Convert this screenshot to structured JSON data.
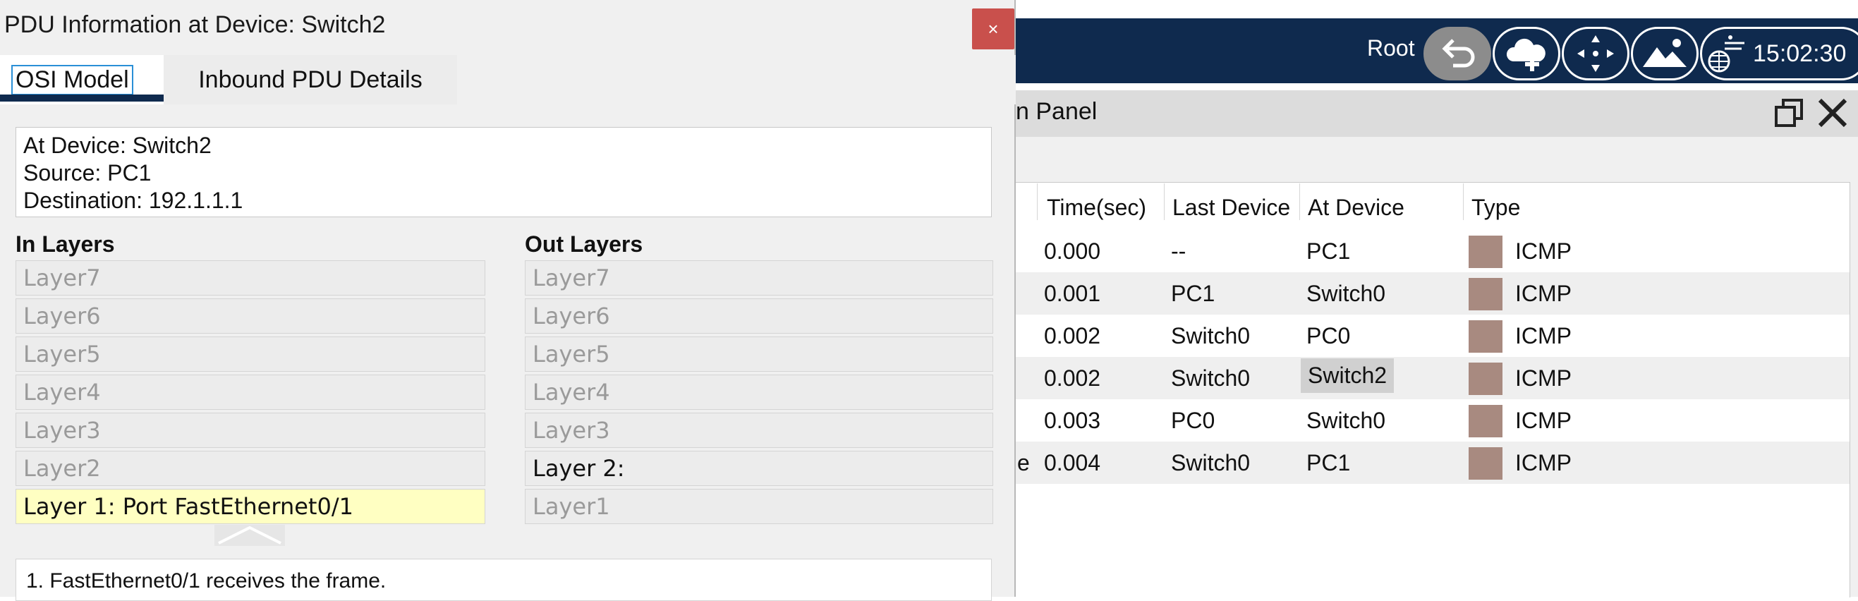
{
  "dialog": {
    "title": "PDU Information at Device: Switch2",
    "close_label": "×",
    "tabs": [
      {
        "label": "OSI Model",
        "active": true
      },
      {
        "label": "Inbound PDU Details",
        "active": false
      }
    ],
    "info_lines": [
      "At Device: Switch2",
      "Source: PC1",
      "Destination: 192.1.1.1"
    ],
    "in_layers": {
      "title": "In Layers",
      "items": [
        "Layer7",
        "Layer6",
        "Layer5",
        "Layer4",
        "Layer3",
        "Layer2",
        "Layer 1: Port FastEthernet0/1"
      ],
      "active_index": 6
    },
    "out_layers": {
      "title": "Out Layers",
      "items": [
        "Layer7",
        "Layer6",
        "Layer5",
        "Layer4",
        "Layer3",
        "Layer 2:",
        "Layer1"
      ],
      "enabled_index": 5
    },
    "description": "1. FastEthernet0/1 receives the frame."
  },
  "app": {
    "user_label": "Root",
    "clock": "15:02:30",
    "toolbar_icons": [
      "undo-icon",
      "cloud-add-icon",
      "move-icon",
      "landscape-icon",
      "network-clock-icon"
    ],
    "panel_title_fragment": "n Panel",
    "colors": {
      "topbar": "#0f2a4e",
      "type_swatch": "#a88a80",
      "dialog_close": "#c9504c",
      "active_layer": "#ffffc2"
    }
  },
  "event_table": {
    "headers": [
      "Time(sec)",
      "Last Device",
      "At Device",
      "Type"
    ],
    "rows": [
      {
        "lead": "",
        "time": "0.000",
        "last": "--",
        "at": "PC1",
        "type": "ICMP"
      },
      {
        "lead": "",
        "time": "0.001",
        "last": "PC1",
        "at": "Switch0",
        "type": "ICMP"
      },
      {
        "lead": "",
        "time": "0.002",
        "last": "Switch0",
        "at": "PC0",
        "type": "ICMP"
      },
      {
        "lead": "",
        "time": "0.002",
        "last": "Switch0",
        "at": "Switch2",
        "type": "ICMP",
        "highlight": true
      },
      {
        "lead": "",
        "time": "0.003",
        "last": "PC0",
        "at": "Switch0",
        "type": "ICMP"
      },
      {
        "lead": "e",
        "time": "0.004",
        "last": "Switch0",
        "at": "PC1",
        "type": "ICMP"
      }
    ]
  }
}
